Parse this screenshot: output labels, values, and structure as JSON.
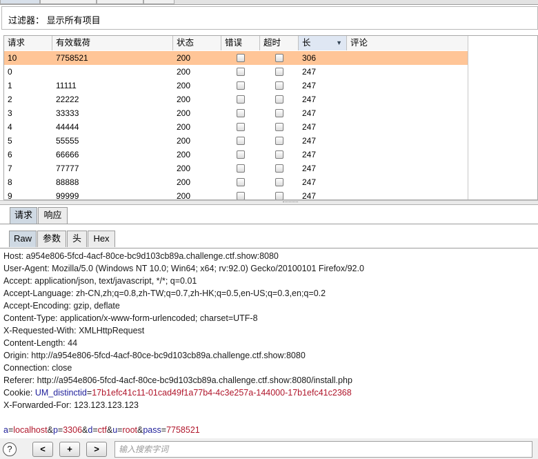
{
  "filter": {
    "label": "过滤器：  显示所有项目"
  },
  "table": {
    "columns": [
      "请求",
      "有效载荷",
      "状态",
      "错误",
      "超时",
      "长",
      "评论"
    ],
    "sorted_column": "长",
    "rows": [
      {
        "request": "10",
        "payload": "7758521",
        "status": "200",
        "error": false,
        "timeout": false,
        "length": "306",
        "comment": ""
      },
      {
        "request": "0",
        "payload": "",
        "status": "200",
        "error": false,
        "timeout": false,
        "length": "247",
        "comment": ""
      },
      {
        "request": "1",
        "payload": "11111",
        "status": "200",
        "error": false,
        "timeout": false,
        "length": "247",
        "comment": ""
      },
      {
        "request": "2",
        "payload": "22222",
        "status": "200",
        "error": false,
        "timeout": false,
        "length": "247",
        "comment": ""
      },
      {
        "request": "3",
        "payload": "33333",
        "status": "200",
        "error": false,
        "timeout": false,
        "length": "247",
        "comment": ""
      },
      {
        "request": "4",
        "payload": "44444",
        "status": "200",
        "error": false,
        "timeout": false,
        "length": "247",
        "comment": ""
      },
      {
        "request": "5",
        "payload": "55555",
        "status": "200",
        "error": false,
        "timeout": false,
        "length": "247",
        "comment": ""
      },
      {
        "request": "6",
        "payload": "66666",
        "status": "200",
        "error": false,
        "timeout": false,
        "length": "247",
        "comment": ""
      },
      {
        "request": "7",
        "payload": "77777",
        "status": "200",
        "error": false,
        "timeout": false,
        "length": "247",
        "comment": ""
      },
      {
        "request": "8",
        "payload": "88888",
        "status": "200",
        "error": false,
        "timeout": false,
        "length": "247",
        "comment": ""
      },
      {
        "request": "9",
        "payload": "99999",
        "status": "200",
        "error": false,
        "timeout": false,
        "length": "247",
        "comment": ""
      }
    ]
  },
  "panel_tabs": [
    "请求",
    "响应"
  ],
  "view_tabs": [
    "Raw",
    "参数",
    "头",
    "Hex"
  ],
  "request_lines": [
    "Host: a954e806-5fcd-4acf-80ce-bc9d103cb89a.challenge.ctf.show:8080",
    "User-Agent: Mozilla/5.0 (Windows NT 10.0; Win64; x64; rv:92.0) Gecko/20100101 Firefox/92.0",
    "Accept: application/json, text/javascript, */*; q=0.01",
    "Accept-Language: zh-CN,zh;q=0.8,zh-TW;q=0.7,zh-HK;q=0.5,en-US;q=0.3,en;q=0.2",
    "Accept-Encoding: gzip, deflate",
    "Content-Type: application/x-www-form-urlencoded; charset=UTF-8",
    "X-Requested-With: XMLHttpRequest",
    "Content-Length: 44",
    "Origin: http://a954e806-5fcd-4acf-80ce-bc9d103cb89a.challenge.ctf.show:8080",
    "Connection: close",
    "Referer: http://a954e806-5fcd-4acf-80ce-bc9d103cb89a.challenge.ctf.show:8080/install.php"
  ],
  "cookie_line": {
    "prefix": "Cookie: ",
    "name": "UM_distinctid",
    "eq": "=",
    "value": "17b1efc41c11-01cad49f1a77b4-4c3e257a-144000-17b1efc41c2368"
  },
  "forwarded_line": "X-Forwarded-For: 123.123.123.123",
  "body_params": [
    {
      "key": "a",
      "value": "localhost"
    },
    {
      "key": "p",
      "value": "3306"
    },
    {
      "key": "d",
      "value": "ctf"
    },
    {
      "key": "u",
      "value": "root"
    },
    {
      "key": "pass",
      "value": "7758521"
    }
  ],
  "bottom": {
    "help": "?",
    "prev": "<",
    "add": "+",
    "next": ">",
    "search_placeholder": "输入搜索字词"
  },
  "colors": {
    "selected_row": "#ffc597",
    "param_key": "#1e1e9a",
    "param_value": "#b0162b"
  },
  "icons": [
    "help-icon",
    "sort-descending-icon"
  ]
}
